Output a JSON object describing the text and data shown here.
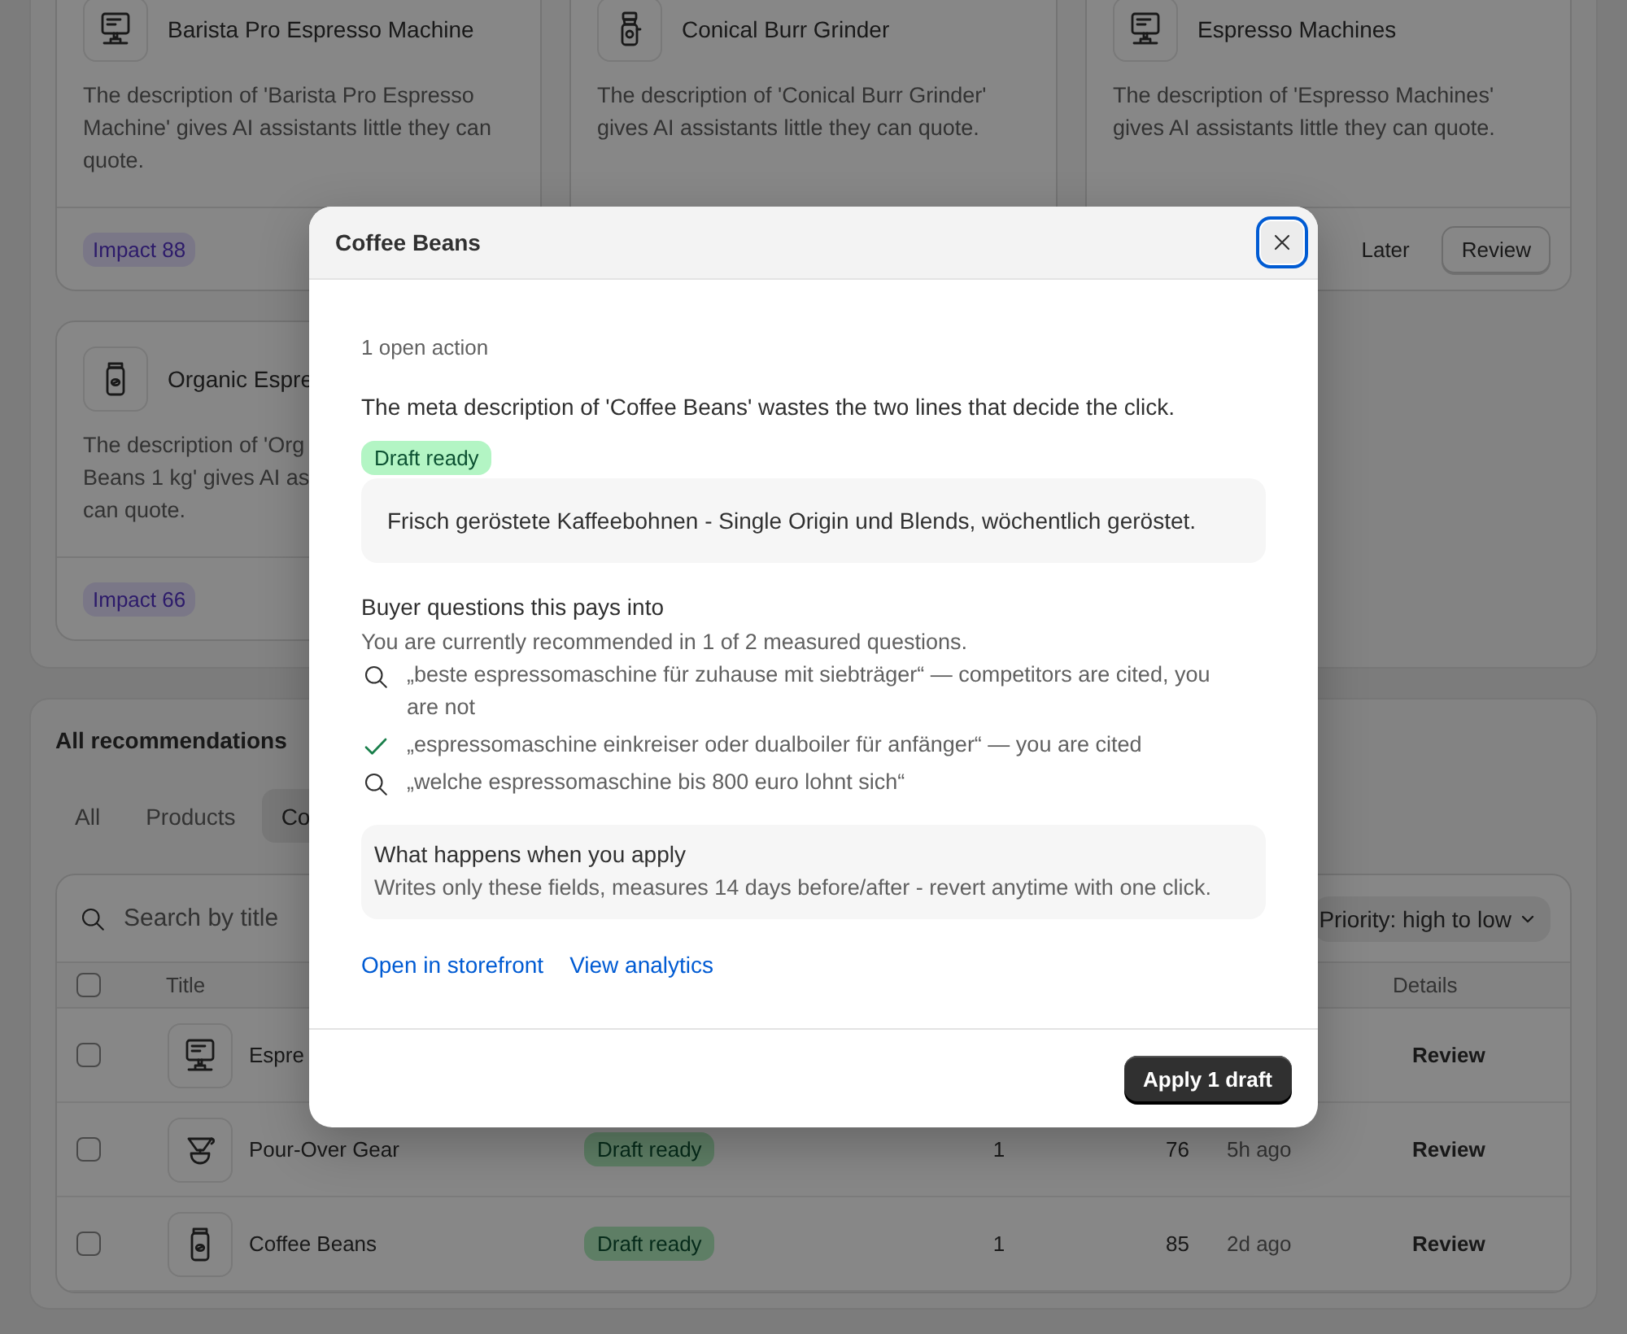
{
  "top_cards": [
    {
      "kind": "machine",
      "title": "Barista Pro Espresso Machine",
      "description_lines": [
        "The description of 'Barista Pro Espresso",
        "Machine' gives AI assistants little they can",
        "quote."
      ],
      "badge": "Impact 88"
    },
    {
      "kind": "grinder",
      "title": "Conical Burr Grinder",
      "description_lines": [
        "The description of 'Conical Burr Grinder'",
        "gives AI assistants little they can quote."
      ]
    },
    {
      "kind": "machine",
      "title": "Espresso Machines",
      "description_lines": [
        "The description of 'Espresso Machines'",
        "gives AI assistants little they can quote."
      ],
      "actions": [
        {
          "label": "Later",
          "kind": "plain"
        },
        {
          "label": "Review",
          "kind": "outline"
        }
      ]
    },
    {
      "kind": "bag",
      "title": "Organic Espre",
      "description_lines": [
        "The description of 'Org",
        "Beans 1 kg' gives AI as",
        "can quote."
      ],
      "badge": "Impact 66"
    }
  ],
  "recommendations": {
    "title": "All recommendations",
    "tabs": [
      {
        "label": "All",
        "selected": false
      },
      {
        "label": "Products",
        "selected": false
      },
      {
        "label": "Co",
        "selected": true
      }
    ],
    "search": {
      "placeholder": "Search by title"
    },
    "sort": {
      "label": "Priority: high to low"
    },
    "header_checked": false,
    "columns": [
      {
        "label": "Title",
        "kind": "title"
      },
      {
        "label": "Details",
        "kind": "details"
      }
    ],
    "rows": [
      {
        "checked": false,
        "kind": "machine",
        "title": "Espre",
        "details": "Review"
      },
      {
        "checked": false,
        "kind": "dripper",
        "title": "Pour-Over Gear",
        "status": "Draft ready",
        "column_4": "1",
        "column_5": "76",
        "column_6": "5h ago",
        "details": "Review"
      },
      {
        "checked": false,
        "kind": "bag",
        "title": "Coffee Beans",
        "status": "Draft ready",
        "column_4": "1",
        "column_5": "85",
        "column_6": "2d ago",
        "details": "Review"
      }
    ]
  },
  "modal": {
    "title": "Coffee Beans",
    "close": {
      "focused": true
    },
    "open_actions": "1 open action",
    "statement": "The meta description of 'Coffee Beans' wastes the two lines that decide the click.",
    "draft": {
      "status": "Draft ready",
      "text": "Frisch geröstete Kaffeebohnen - Single Origin und Blends, wöchentlich geröstet."
    },
    "questions": {
      "title": "Buyer questions this pays into",
      "summary": "You are currently recommended in 1 of 2 measured questions.",
      "items": [
        {
          "text": "„beste espressomaschine für zuhause mit siebträger“ — competitors are cited, you are not",
          "cited": false
        },
        {
          "text": "„espressomaschine einkreiser oder dualboiler für anfänger“ — you are cited",
          "cited": true
        },
        {
          "text": "„welche espressomaschine bis 800 euro lohnt sich“",
          "cited": false
        }
      ]
    },
    "info": {
      "title": "What happens when you apply",
      "text": "Writes only these fields, measures 14 days before/after - revert anytime with one click."
    },
    "links": [
      "Open in storefront",
      "View analytics"
    ],
    "primary_action": "Apply 1 draft"
  }
}
